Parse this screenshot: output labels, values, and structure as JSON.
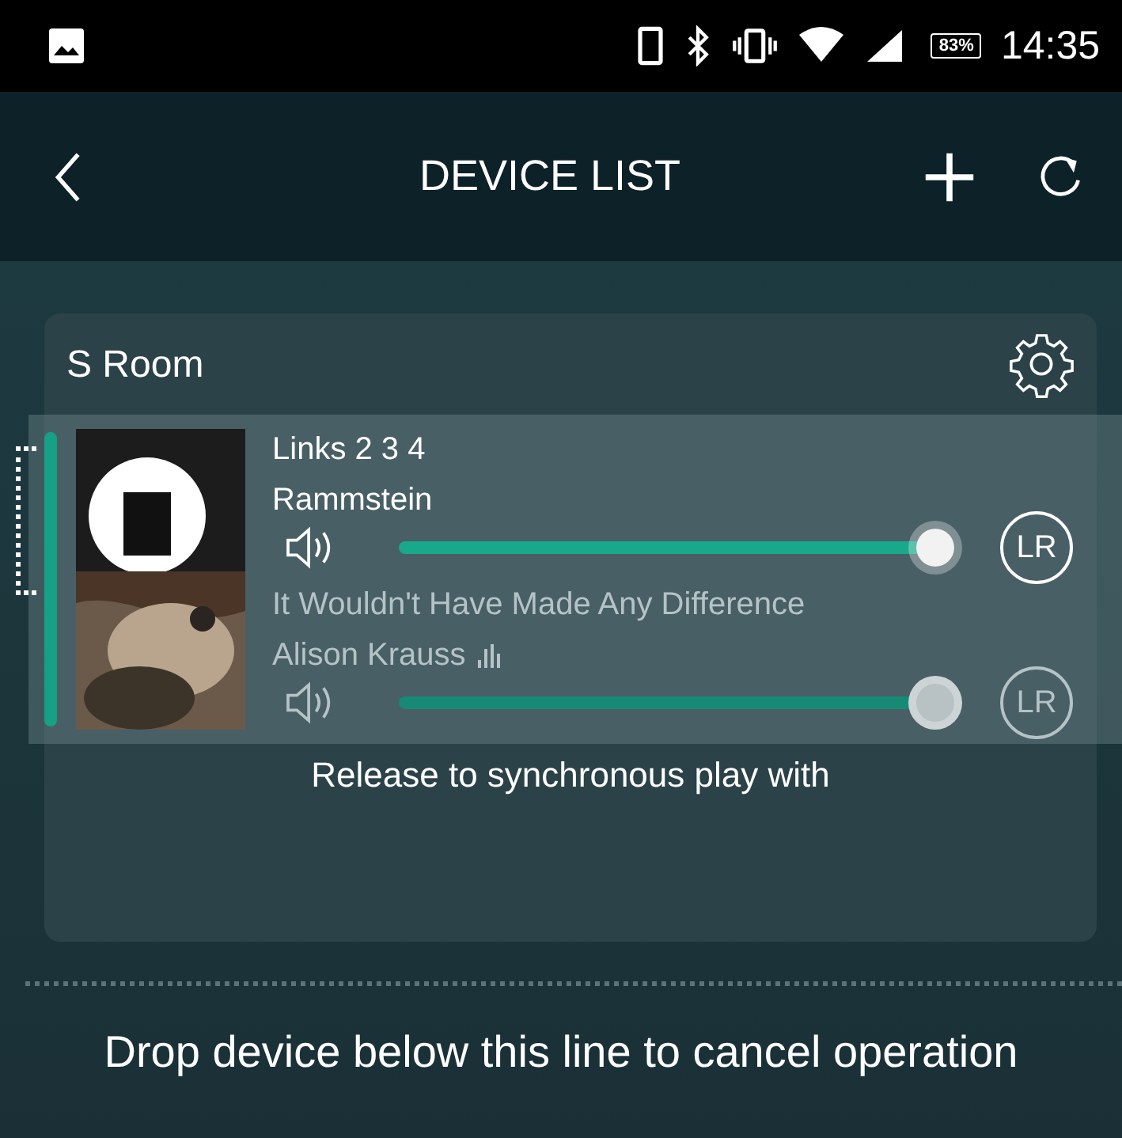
{
  "status_bar": {
    "battery": "83%",
    "time": "14:35"
  },
  "app_bar": {
    "title": "DEVICE LIST"
  },
  "group": {
    "name": "S Room"
  },
  "dragged_item": {
    "tracks": [
      {
        "title": "Links 2 3 4",
        "artist": "Rammstein",
        "level": 0.97,
        "active": true,
        "playing": false,
        "channel": "LR"
      },
      {
        "title": "It Wouldn't Have Made Any Difference",
        "artist": "Alison Krauss",
        "level": 0.97,
        "active": false,
        "playing": true,
        "channel": "LR"
      }
    ]
  },
  "release_hint": "Release to synchronous play with",
  "cancel_hint": "Drop device below this line to cancel operation"
}
